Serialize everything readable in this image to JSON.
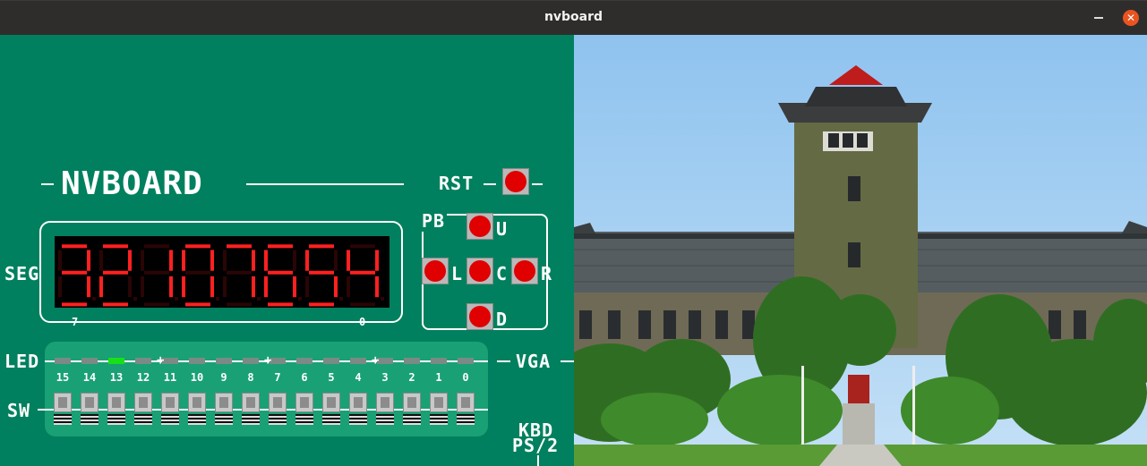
{
  "window": {
    "title": "nvboard",
    "close_glyph": "✕"
  },
  "board": {
    "logo": "NVBOARD",
    "rst_label": "RST",
    "seg_label": "SEG",
    "seg_value": "32107654",
    "seg_index_left": "7",
    "seg_index_right": "0",
    "pb_label": "PB",
    "buttons": {
      "u": "U",
      "l": "L",
      "c": "C",
      "r": "R",
      "d": "D"
    },
    "led_label": "LED",
    "sw_label": "SW",
    "vga_label": "VGA",
    "kbd_label": "KBD",
    "ps2_label": "PS/2",
    "led_numbers": [
      "15",
      "14",
      "13",
      "12",
      "11",
      "10",
      "9",
      "8",
      "7",
      "6",
      "5",
      "4",
      "3",
      "2",
      "1",
      "0"
    ],
    "led_states": [
      false,
      false,
      true,
      false,
      false,
      false,
      false,
      false,
      false,
      false,
      false,
      false,
      false,
      false,
      false,
      false
    ],
    "switch_states": [
      false,
      false,
      false,
      false,
      false,
      false,
      false,
      false,
      false,
      false,
      false,
      false,
      false,
      false,
      false,
      false
    ]
  },
  "colors": {
    "board": "#00805e",
    "segment_on": "#ff2020",
    "segment_off": "#2a0505",
    "led_on": "#18e018",
    "button": "#e00000",
    "titlebar": "#2f2d2c",
    "close": "#e95420"
  },
  "vga": {
    "scene": "campus building tower photo"
  }
}
